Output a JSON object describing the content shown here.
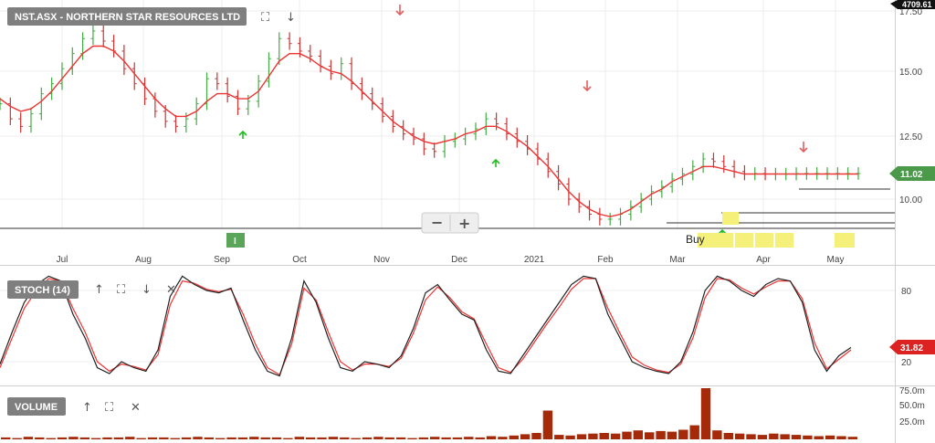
{
  "price_panel": {
    "title": "NST.ASX - NORTHERN STAR RESOURCES LTD",
    "top_value": "4709.61",
    "last_value": "11.02",
    "buy_label": "Buy",
    "indicator_marker": "I",
    "zoom_out": "−",
    "zoom_in": "+"
  },
  "stoch_panel": {
    "title": "STOCH (14)",
    "last_value": "31.82"
  },
  "volume_panel": {
    "title": "VOLUME"
  },
  "colors": {
    "up_bar": "#44aa44",
    "down_bar": "#cc3333",
    "moving_average": "#ee3333",
    "stoch_k": "#222222",
    "stoch_d": "#ee3333",
    "volume_bar": "#a52a0a",
    "last_value_badge": "#4a9a4a",
    "stoch_badge": "#dd2222",
    "buy_signal_box": "#f5f07a",
    "up_arrow": "#22bb22",
    "down_arrow": "#e06060"
  },
  "icons": [
    "expand-icon",
    "move-down-icon",
    "move-up-icon",
    "close-icon"
  ],
  "chart_data": [
    {
      "type": "ohlc",
      "x_labels": [
        "Jul",
        "Aug",
        "Sep",
        "Oct",
        "Nov",
        "Dec",
        "2021",
        "Feb",
        "Mar",
        "Apr",
        "May"
      ],
      "y_ticks": [
        "17.50",
        "15.00",
        "12.50",
        "10.00"
      ],
      "ylim": [
        8.0,
        18.0
      ],
      "series": [
        {
          "name": "Close",
          "x": [
            0,
            3,
            6,
            9,
            12,
            15,
            18,
            21,
            24,
            27,
            30,
            33,
            36,
            39,
            42,
            45,
            48,
            51,
            54,
            57,
            60,
            63,
            66,
            69,
            72,
            75,
            78,
            81,
            84,
            87,
            90,
            93,
            96,
            99,
            102,
            105,
            108,
            111,
            114,
            117,
            120,
            123,
            126,
            129,
            132,
            135,
            138,
            141,
            144,
            147,
            150,
            153,
            156,
            159,
            162,
            165,
            168,
            171,
            174,
            177,
            180,
            183,
            186,
            189,
            192,
            195,
            198,
            201,
            204,
            207,
            210,
            213,
            216,
            219,
            222,
            225,
            228,
            231,
            234,
            237,
            240,
            243,
            246,
            249
          ],
          "values": [
            13.8,
            13.2,
            12.9,
            13.4,
            14.2,
            14.6,
            15.2,
            15.8,
            16.4,
            16.7,
            16.3,
            15.9,
            15.2,
            14.6,
            14.0,
            13.5,
            13.1,
            12.9,
            13.2,
            13.8,
            14.8,
            14.6,
            14.1,
            13.6,
            13.9,
            14.7,
            15.6,
            16.4,
            16.2,
            15.9,
            15.7,
            15.3,
            15.0,
            15.4,
            14.6,
            14.2,
            13.8,
            13.3,
            12.9,
            12.6,
            12.4,
            12.0,
            11.9,
            12.3,
            12.4,
            12.6,
            12.8,
            13.2,
            13.0,
            12.6,
            12.3,
            12.0,
            11.6,
            11.1,
            10.6,
            10.0,
            9.7,
            9.4,
            9.2,
            9.2,
            9.4,
            9.7,
            10.0,
            10.3,
            10.5,
            10.8,
            11.0,
            11.3,
            11.6,
            11.5,
            11.3,
            11.1,
            11.0,
            11.02,
            11.0,
            11.0,
            11.0,
            11.02,
            11.02,
            11.02,
            11.02,
            11.02,
            11.02,
            11.02
          ]
        }
      ],
      "moving_average": {
        "name": "MA",
        "values": [
          14.0,
          13.7,
          13.5,
          13.6,
          13.9,
          14.3,
          14.8,
          15.3,
          15.8,
          16.1,
          16.1,
          15.9,
          15.5,
          15.0,
          14.5,
          14.0,
          13.6,
          13.3,
          13.3,
          13.5,
          13.9,
          14.2,
          14.2,
          14.0,
          14.0,
          14.3,
          14.9,
          15.5,
          15.8,
          15.8,
          15.6,
          15.3,
          15.1,
          15.0,
          14.7,
          14.3,
          13.9,
          13.5,
          13.1,
          12.8,
          12.5,
          12.3,
          12.2,
          12.3,
          12.4,
          12.6,
          12.7,
          12.9,
          12.9,
          12.7,
          12.4,
          12.1,
          11.7,
          11.3,
          10.8,
          10.3,
          9.9,
          9.6,
          9.4,
          9.3,
          9.4,
          9.6,
          9.9,
          10.2,
          10.4,
          10.7,
          10.9,
          11.1,
          11.3,
          11.3,
          11.2,
          11.1,
          11.0,
          11.0,
          11.0,
          11.0,
          11.0,
          11.0,
          11.0,
          11.0,
          11.0,
          11.0,
          11.0,
          11.0
        ]
      }
    },
    {
      "type": "line",
      "title": "STOCH (14)",
      "y_ticks": [
        "80",
        "20"
      ],
      "ylim": [
        0,
        100
      ],
      "series": [
        {
          "name": "%K",
          "values": [
            18,
            45,
            70,
            85,
            92,
            88,
            60,
            40,
            15,
            10,
            20,
            15,
            12,
            30,
            75,
            92,
            85,
            80,
            78,
            82,
            55,
            30,
            12,
            8,
            40,
            88,
            70,
            40,
            15,
            12,
            20,
            18,
            15,
            25,
            48,
            78,
            85,
            72,
            60,
            55,
            30,
            12,
            10,
            25,
            40,
            55,
            70,
            85,
            92,
            90,
            60,
            40,
            20,
            15,
            12,
            10,
            20,
            45,
            80,
            92,
            88,
            80,
            75,
            85,
            90,
            88,
            70,
            30,
            12,
            25,
            32
          ]
        },
        {
          "name": "%D",
          "values": [
            15,
            40,
            65,
            80,
            90,
            88,
            65,
            45,
            20,
            12,
            18,
            16,
            13,
            26,
            68,
            88,
            86,
            81,
            79,
            81,
            60,
            35,
            15,
            9,
            35,
            82,
            72,
            45,
            20,
            13,
            18,
            18,
            16,
            23,
            44,
            72,
            83,
            74,
            62,
            56,
            35,
            15,
            11,
            22,
            37,
            52,
            66,
            81,
            90,
            90,
            65,
            44,
            24,
            17,
            13,
            11,
            18,
            40,
            74,
            90,
            89,
            82,
            77,
            83,
            88,
            88,
            73,
            36,
            14,
            22,
            30
          ]
        }
      ]
    },
    {
      "type": "bar",
      "title": "VOLUME",
      "y_ticks": [
        "75.0m",
        "50.0m",
        "25.0m"
      ],
      "ylim": [
        0,
        80
      ],
      "series": [
        {
          "name": "Volume",
          "values": [
            3,
            2,
            4,
            3,
            2,
            3,
            4,
            3,
            2,
            3,
            3,
            4,
            2,
            3,
            3,
            2,
            3,
            4,
            3,
            2,
            3,
            3,
            4,
            3,
            3,
            2,
            4,
            3,
            3,
            4,
            3,
            2,
            3,
            4,
            3,
            3,
            2,
            3,
            4,
            3,
            3,
            4,
            3,
            5,
            4,
            6,
            8,
            10,
            45,
            7,
            6,
            8,
            9,
            10,
            9,
            12,
            14,
            11,
            13,
            12,
            15,
            22,
            80,
            14,
            10,
            9,
            8,
            7,
            9,
            8,
            7,
            6,
            5,
            6,
            5,
            4
          ]
        }
      ]
    }
  ]
}
